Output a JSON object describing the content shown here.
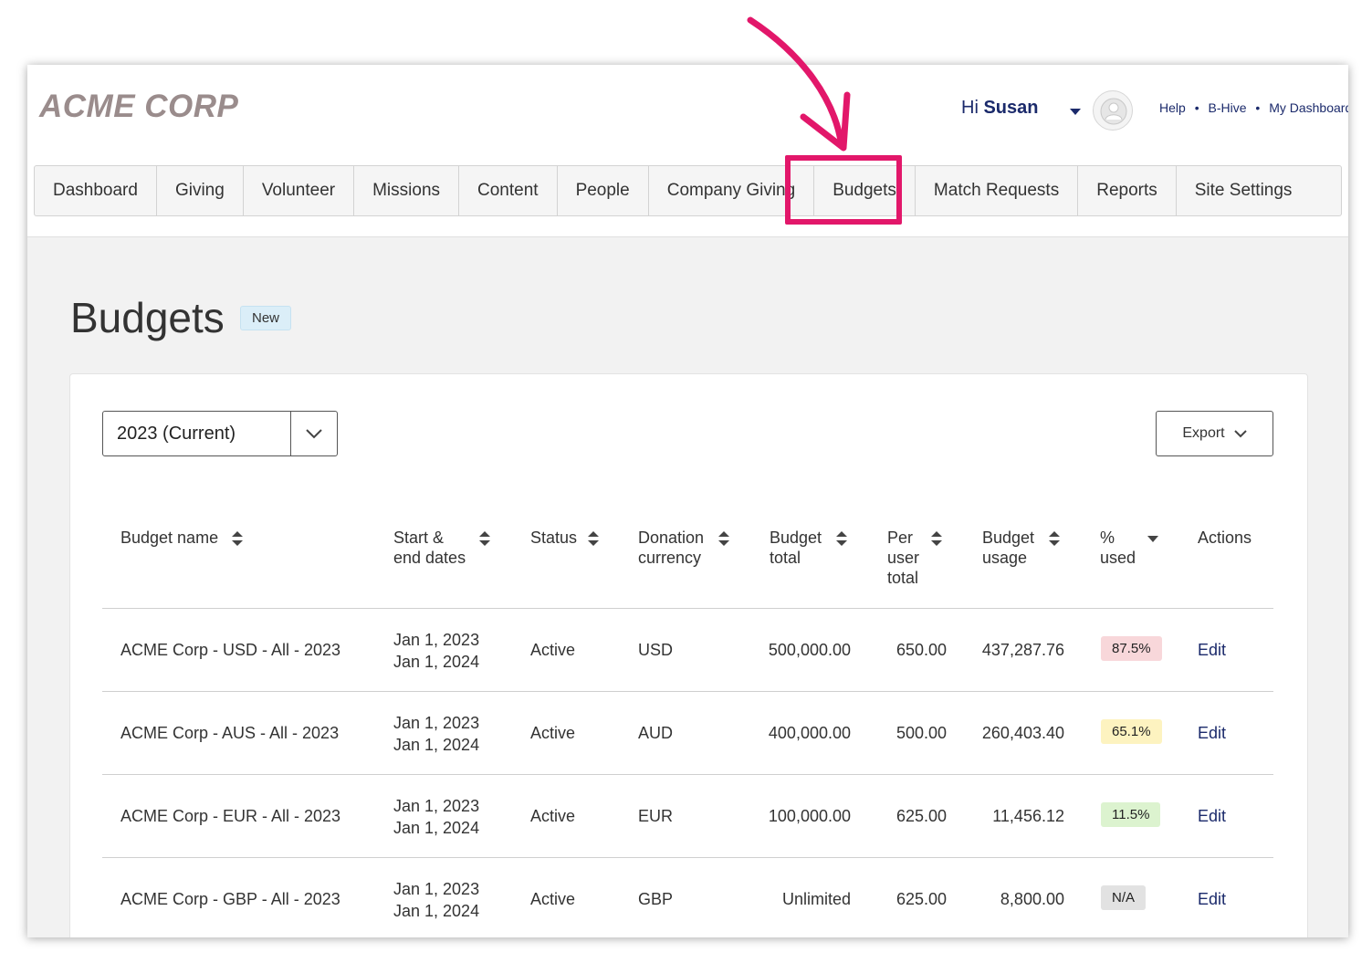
{
  "brand": {
    "logo_text": "ACME CORP"
  },
  "user": {
    "greeting_prefix": "Hi",
    "name": "Susan"
  },
  "toplinks": {
    "help": "Help",
    "bhive": "B-Hive",
    "dashboard": "My Dashboard",
    "separator": "•"
  },
  "nav": {
    "tabs": [
      "Dashboard",
      "Giving",
      "Volunteer",
      "Missions",
      "Content",
      "People",
      "Company Giving",
      "Budgets",
      "Match Requests",
      "Reports",
      "Site Settings"
    ],
    "highlighted": "Budgets",
    "highlight_color": "#e2176a"
  },
  "page": {
    "title": "Budgets",
    "badge": "New"
  },
  "filters": {
    "year_value": "2023 (Current)",
    "export_label": "Export"
  },
  "table": {
    "headers": {
      "name": "Budget name",
      "dates_l1": "Start &",
      "dates_l2": "end dates",
      "status": "Status",
      "currency_l1": "Donation",
      "currency_l2": "currency",
      "total_l1": "Budget",
      "total_l2": "total",
      "peruser_l1": "Per",
      "peruser_l2": "user",
      "peruser_l3": "total",
      "usage_l1": "Budget",
      "usage_l2": "usage",
      "pct_l1": "%",
      "pct_l2": "used",
      "actions": "Actions"
    },
    "rows": [
      {
        "name": "ACME Corp - USD - All - 2023",
        "start": "Jan 1, 2023",
        "end": "Jan 1, 2024",
        "status": "Active",
        "currency": "USD",
        "total": "500,000.00",
        "per_user": "650.00",
        "usage": "437,287.76",
        "pct": "87.5%",
        "pct_level": "red",
        "action": "Edit"
      },
      {
        "name": "ACME Corp - AUS - All - 2023",
        "start": "Jan 1, 2023",
        "end": "Jan 1, 2024",
        "status": "Active",
        "currency": "AUD",
        "total": "400,000.00",
        "per_user": "500.00",
        "usage": "260,403.40",
        "pct": "65.1%",
        "pct_level": "yellow",
        "action": "Edit"
      },
      {
        "name": "ACME Corp - EUR - All - 2023",
        "start": "Jan 1, 2023",
        "end": "Jan 1, 2024",
        "status": "Active",
        "currency": "EUR",
        "total": "100,000.00",
        "per_user": "625.00",
        "usage": "11,456.12",
        "pct": "11.5%",
        "pct_level": "green",
        "action": "Edit"
      },
      {
        "name": "ACME Corp - GBP - All - 2023",
        "start": "Jan 1, 2023",
        "end": "Jan 1, 2024",
        "status": "Active",
        "currency": "GBP",
        "total": "Unlimited",
        "per_user": "625.00",
        "usage": "8,800.00",
        "pct": "N/A",
        "pct_level": "grey",
        "action": "Edit"
      }
    ]
  },
  "icons": {
    "sort": "sort-icon",
    "sort_desc": "caret-down-icon",
    "select": "chevron-down-icon",
    "avatar": "user-avatar-icon",
    "annotation": "annotation-arrow-icon"
  }
}
